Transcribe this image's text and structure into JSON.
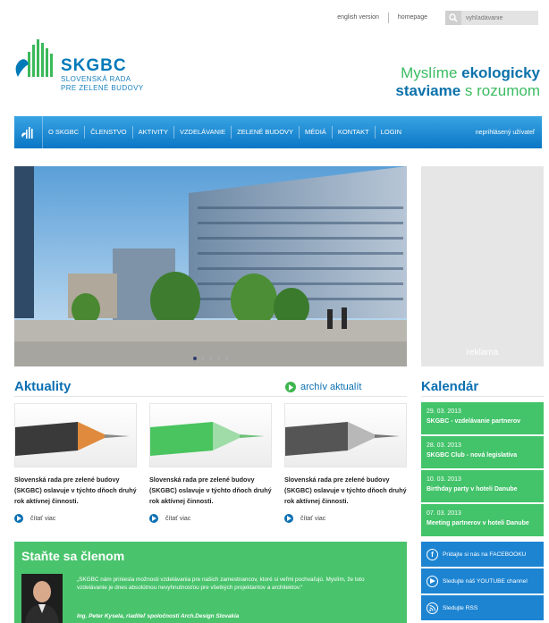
{
  "topbar": {
    "english_label": "english version",
    "homepage_label": "homepage",
    "search_placeholder": "vyhľadávanie"
  },
  "header": {
    "brand": "SKGBC",
    "subtitle_line1": "SLOVENSKÁ RADA",
    "subtitle_line2": "PRE ZELENÉ BUDOVY",
    "slogan_line1_a": "Myslíme ",
    "slogan_line1_b": "ekologicky",
    "slogan_line2_a": "staviame",
    "slogan_line2_b": " s rozumom"
  },
  "nav": {
    "items": [
      "O SKGBC",
      "ČLENSTVO",
      "AKTIVITY",
      "VZDELÁVANIE",
      "ZELENÉ BUDOVY",
      "MÉDIÁ",
      "KONTAKT",
      "LOGIN"
    ],
    "user_status": "neprihlásený užívateľ"
  },
  "ad": {
    "label": "reklama"
  },
  "news": {
    "heading": "Aktuality",
    "archive_label": "archív aktualít",
    "read_more": "čítať viac",
    "items": [
      {
        "text": "Slovenská rada pre zelené budovy (SKGBC) oslavuje v týchto dňoch druhý rok aktívnej činnosti."
      },
      {
        "text": "Slovenská rada pre zelené budovy (SKGBC) oslavuje v týchto dňoch druhý rok aktívnej činnosti."
      },
      {
        "text": "Slovenská rada pre zelené budovy (SKGBC) oslavuje v týchto dňoch druhý rok aktívnej činnosti."
      }
    ]
  },
  "calendar": {
    "heading": "Kalendár",
    "events": [
      {
        "date": "29. 03. 2013",
        "title": "SKGBC - vzdelávanie partnerov"
      },
      {
        "date": "28. 03. 2013",
        "title": "SKGBC Club - nová legislatíva"
      },
      {
        "date": "10. 03. 2013",
        "title": "Birthday party v hoteli Danube"
      },
      {
        "date": "07. 03. 2013",
        "title": "Meeting partnerov v hoteli Danube"
      }
    ]
  },
  "member": {
    "heading": "Staňte sa členom",
    "quote": "„SKGBC nám priniesla možnosti vzdelávania pre našich zamestnancov, ktoré si veľmi pochvaľujú. Myslím, že toto vzdelávanie je dnes absolútnou nevyhnutnosťou pre všetkých projektantov a architektov.“",
    "author": "Ing. Peter Kysela, riaditeľ spoločnosti Arch.Design Slovakia"
  },
  "social": {
    "facebook": "Pridajte si nás na FACEBOOKU",
    "youtube": "Sledujte náš YOUTUBE channel",
    "rss": "Sledujte RSS"
  },
  "colors": {
    "brand_blue": "#0c70b3",
    "brand_green": "#43c36a",
    "nav_blue": "#0b76c4"
  },
  "hero": {
    "slide_count": 5,
    "active_slide": 1
  }
}
